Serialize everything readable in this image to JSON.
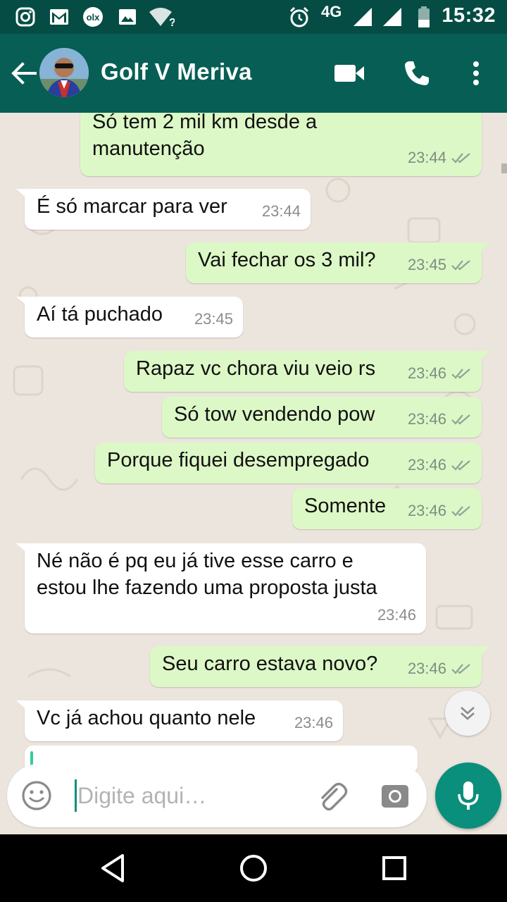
{
  "status_bar": {
    "network": "4G",
    "time": "15:32"
  },
  "header": {
    "contact_name": "Golf V Meriva"
  },
  "messages": [
    {
      "direction": "out",
      "lines": [
        "Só tem 2 mil km desde a",
        "manutenção"
      ],
      "time": "23:44",
      "status": "read"
    },
    {
      "direction": "in",
      "lines": [
        "É só marcar para ver"
      ],
      "time": "23:44"
    },
    {
      "direction": "out",
      "lines": [
        "Vai fechar os 3 mil?"
      ],
      "time": "23:45",
      "status": "read"
    },
    {
      "direction": "in",
      "lines": [
        "Aí tá puchado"
      ],
      "time": "23:45"
    },
    {
      "direction": "out",
      "lines": [
        "Rapaz vc chora viu veio rs"
      ],
      "time": "23:46",
      "status": "read"
    },
    {
      "direction": "out",
      "lines": [
        "Só tow vendendo pow"
      ],
      "time": "23:46",
      "status": "read"
    },
    {
      "direction": "out",
      "lines": [
        "Porque fiquei desempregado"
      ],
      "time": "23:46",
      "status": "read"
    },
    {
      "direction": "out",
      "lines": [
        "Somente"
      ],
      "time": "23:46",
      "status": "read"
    },
    {
      "direction": "in",
      "lines": [
        "Né não é pq eu já tive esse carro e",
        "estou lhe fazendo uma proposta justa"
      ],
      "time": "23:46"
    },
    {
      "direction": "out",
      "lines": [
        "Seu carro estava novo?"
      ],
      "time": "23:46",
      "status": "read"
    },
    {
      "direction": "in",
      "lines": [
        "Vc já achou quanto nele"
      ],
      "time": "23:46"
    }
  ],
  "composer": {
    "placeholder": "Digite aqui…"
  },
  "icons": {
    "status_left": [
      "instagram-icon",
      "gmail-icon",
      "olx-icon",
      "image-icon",
      "wifi-unknown-icon"
    ],
    "status_right": [
      "alarm-icon",
      "signal-icon",
      "signal-icon",
      "battery-icon"
    ],
    "header": [
      "back-arrow-icon",
      "video-call-icon",
      "phone-icon",
      "more-vert-icon"
    ],
    "composer": [
      "emoji-icon",
      "attach-icon",
      "camera-icon",
      "mic-icon"
    ],
    "nav": [
      "back-triangle-icon",
      "home-circle-icon",
      "recents-square-icon"
    ]
  },
  "colors": {
    "header": "#075e54",
    "status_bar": "#054d44",
    "outgoing_bubble": "#dcf8c6",
    "incoming_bubble": "#ffffff",
    "chat_background": "#ece5dd",
    "accent": "#0a8f7c",
    "read_ticks": "#8fa397"
  }
}
